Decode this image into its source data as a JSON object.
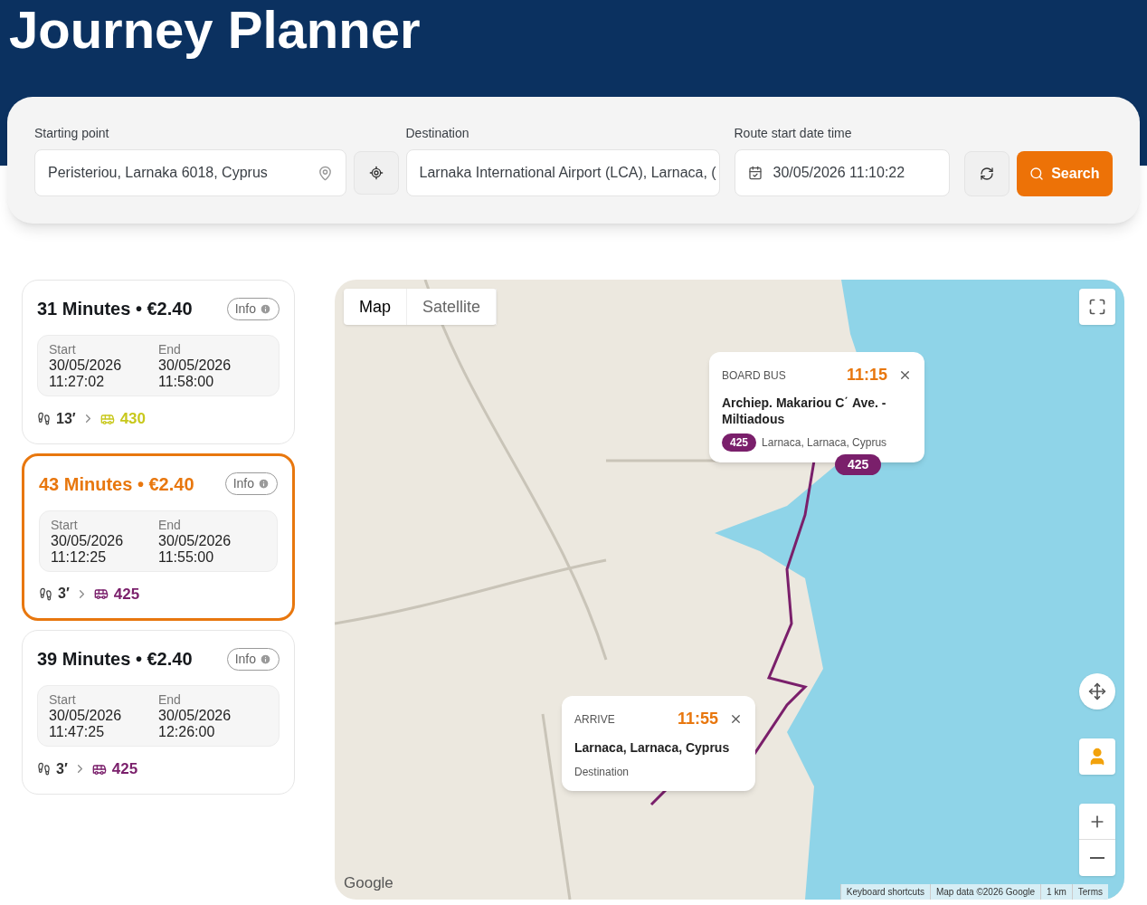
{
  "header": {
    "title": "Journey Planner"
  },
  "search": {
    "starting_point": {
      "label": "Starting point",
      "value": "Peristeriou, Larnaka 6018, Cyprus"
    },
    "destination": {
      "label": "Destination",
      "value": "Larnaka International Airport (LCA), Larnaca, ("
    },
    "date_time": {
      "label": "Route start date time",
      "value": "30/05/2026 11:10:22"
    },
    "search_button": "Search"
  },
  "journeys": [
    {
      "title": "31 Minutes",
      "separator": "•",
      "price": "€2.40",
      "selected": false,
      "info": "Info",
      "start_label": "Start",
      "start_date": "30/05/2026",
      "start_time": "11:27:02",
      "end_label": "End",
      "end_date": "30/05/2026",
      "end_time": "11:58:00",
      "walk": "13′",
      "route": "430",
      "color": "#c8c81c"
    },
    {
      "title": "43 Minutes",
      "separator": "•",
      "price": "€2.40",
      "selected": true,
      "info": "Info",
      "start_label": "Start",
      "start_date": "30/05/2026",
      "start_time": "11:12:25",
      "end_label": "End",
      "end_date": "30/05/2026",
      "end_time": "11:55:00",
      "walk": "3′",
      "route": "425",
      "color": "#7a1f6b"
    },
    {
      "title": "39 Minutes",
      "separator": "•",
      "price": "€2.40",
      "selected": false,
      "info": "Info",
      "start_label": "Start",
      "start_date": "30/05/2026",
      "start_time": "11:47:25",
      "end_label": "End",
      "end_date": "30/05/2026",
      "end_time": "12:26:00",
      "walk": "3′",
      "route": "425",
      "color": "#7a1f6b"
    }
  ],
  "map": {
    "tabs": [
      {
        "label": "Map",
        "selected": true
      },
      {
        "label": "Satellite",
        "selected": false
      }
    ],
    "board_popup": {
      "kind_label": "BOARD BUS",
      "time": "11:15",
      "stop": "Archiep. Makariou C΄ Ave. - Miltiadous",
      "route": "425",
      "place": "Larnaca, Larnaca, Cyprus"
    },
    "route_badge": "425",
    "arrive_popup": {
      "kind_label": "ARRIVE",
      "time": "11:55",
      "place": "Larnaca, Larnaca, Cyprus",
      "note": "Destination"
    },
    "logo": "Google",
    "footer": [
      "Keyboard shortcuts",
      "Map data ©2026 Google",
      "1 km",
      "Terms"
    ]
  }
}
